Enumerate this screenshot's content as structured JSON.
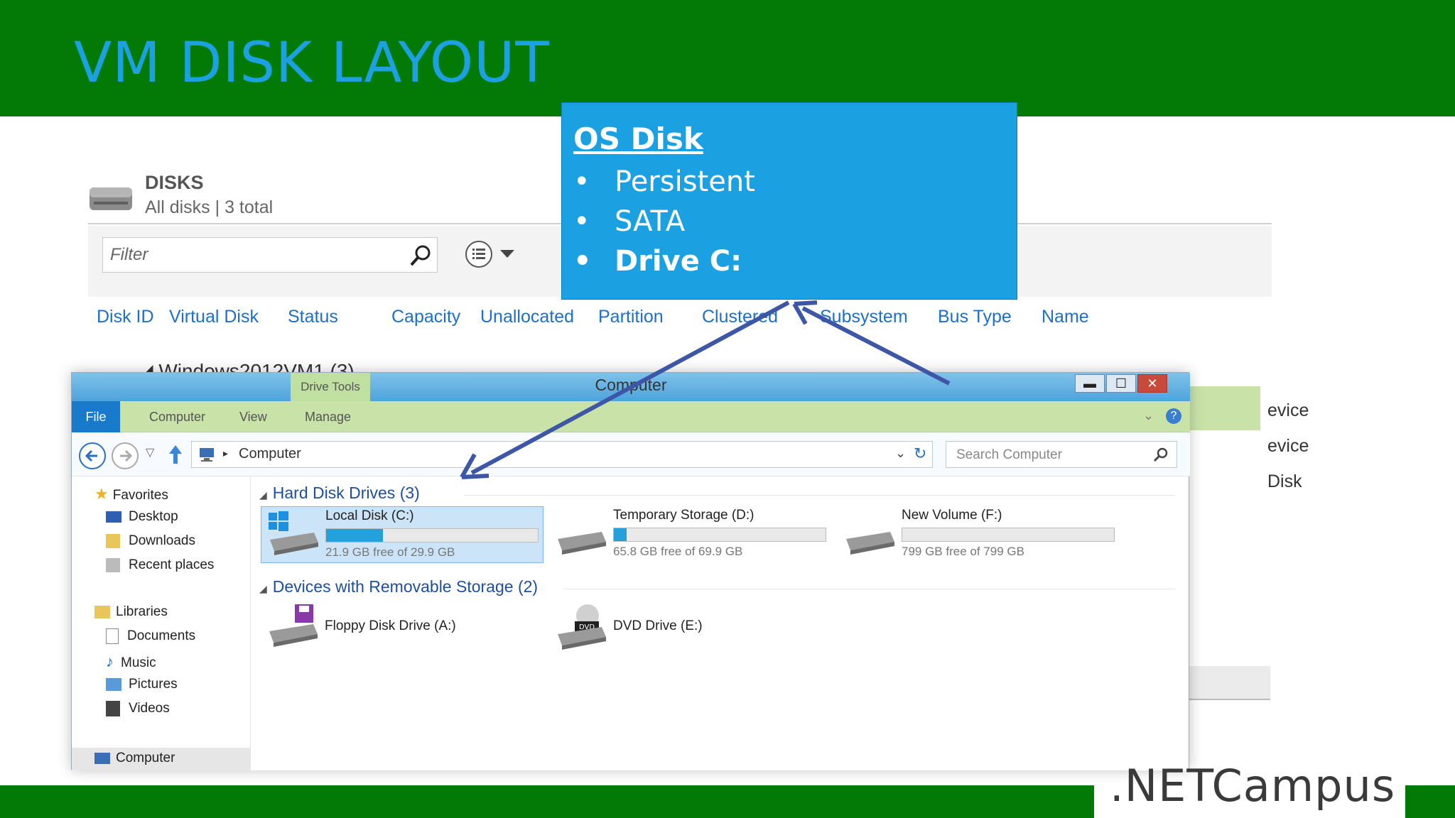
{
  "slide": {
    "title": "VM DISK LAYOUT",
    "logo": ".NETCampus"
  },
  "disks": {
    "title": "DISKS",
    "subtitle": "All disks | 3 total",
    "filter_placeholder": "Filter",
    "columns": [
      "Disk ID",
      "Virtual Disk",
      "Status",
      "Capacity",
      "Unallocated",
      "Partition",
      "Clustered",
      "Subsystem",
      "Bus Type",
      "Name"
    ],
    "group": "Windows2012VM1 (3)",
    "right_fragments": [
      "evice",
      "evice",
      "Disk"
    ]
  },
  "explorer": {
    "window_title": "Computer",
    "drive_tools": "Drive Tools",
    "ribbon_tabs": [
      "File",
      "Computer",
      "View",
      "Manage"
    ],
    "address": "Computer",
    "search_placeholder": "Search Computer",
    "nav": {
      "favorites": "Favorites",
      "favorites_items": [
        "Desktop",
        "Downloads",
        "Recent places"
      ],
      "libraries": "Libraries",
      "libraries_items": [
        "Documents",
        "Music",
        "Pictures",
        "Videos"
      ],
      "computer": "Computer"
    },
    "sections": {
      "hard_disks": "Hard Disk Drives (3)",
      "removable": "Devices with Removable Storage (2)"
    },
    "drives": [
      {
        "name": "Local Disk (C:)",
        "free": "21.9 GB free of 29.9 GB",
        "used_fraction": 0.27
      },
      {
        "name": "Temporary Storage (D:)",
        "free": "65.8 GB free of 69.9 GB",
        "used_fraction": 0.06
      },
      {
        "name": "New Volume (F:)",
        "free": "799 GB free of 799 GB",
        "used_fraction": 0.0
      }
    ],
    "removable": [
      "Floppy Disk Drive (A:)",
      "DVD Drive (E:)"
    ],
    "window_buttons": {
      "min": "▬",
      "max": "☐",
      "close": "✕"
    }
  },
  "callout": {
    "title": "OS Disk",
    "bullets": [
      "Persistent",
      "SATA",
      "Drive C:"
    ],
    "bullet_symbol": "•"
  },
  "colors": {
    "green": "#037a05",
    "accent_blue": "#1ba1e2",
    "arrow": "#3d56a6"
  }
}
